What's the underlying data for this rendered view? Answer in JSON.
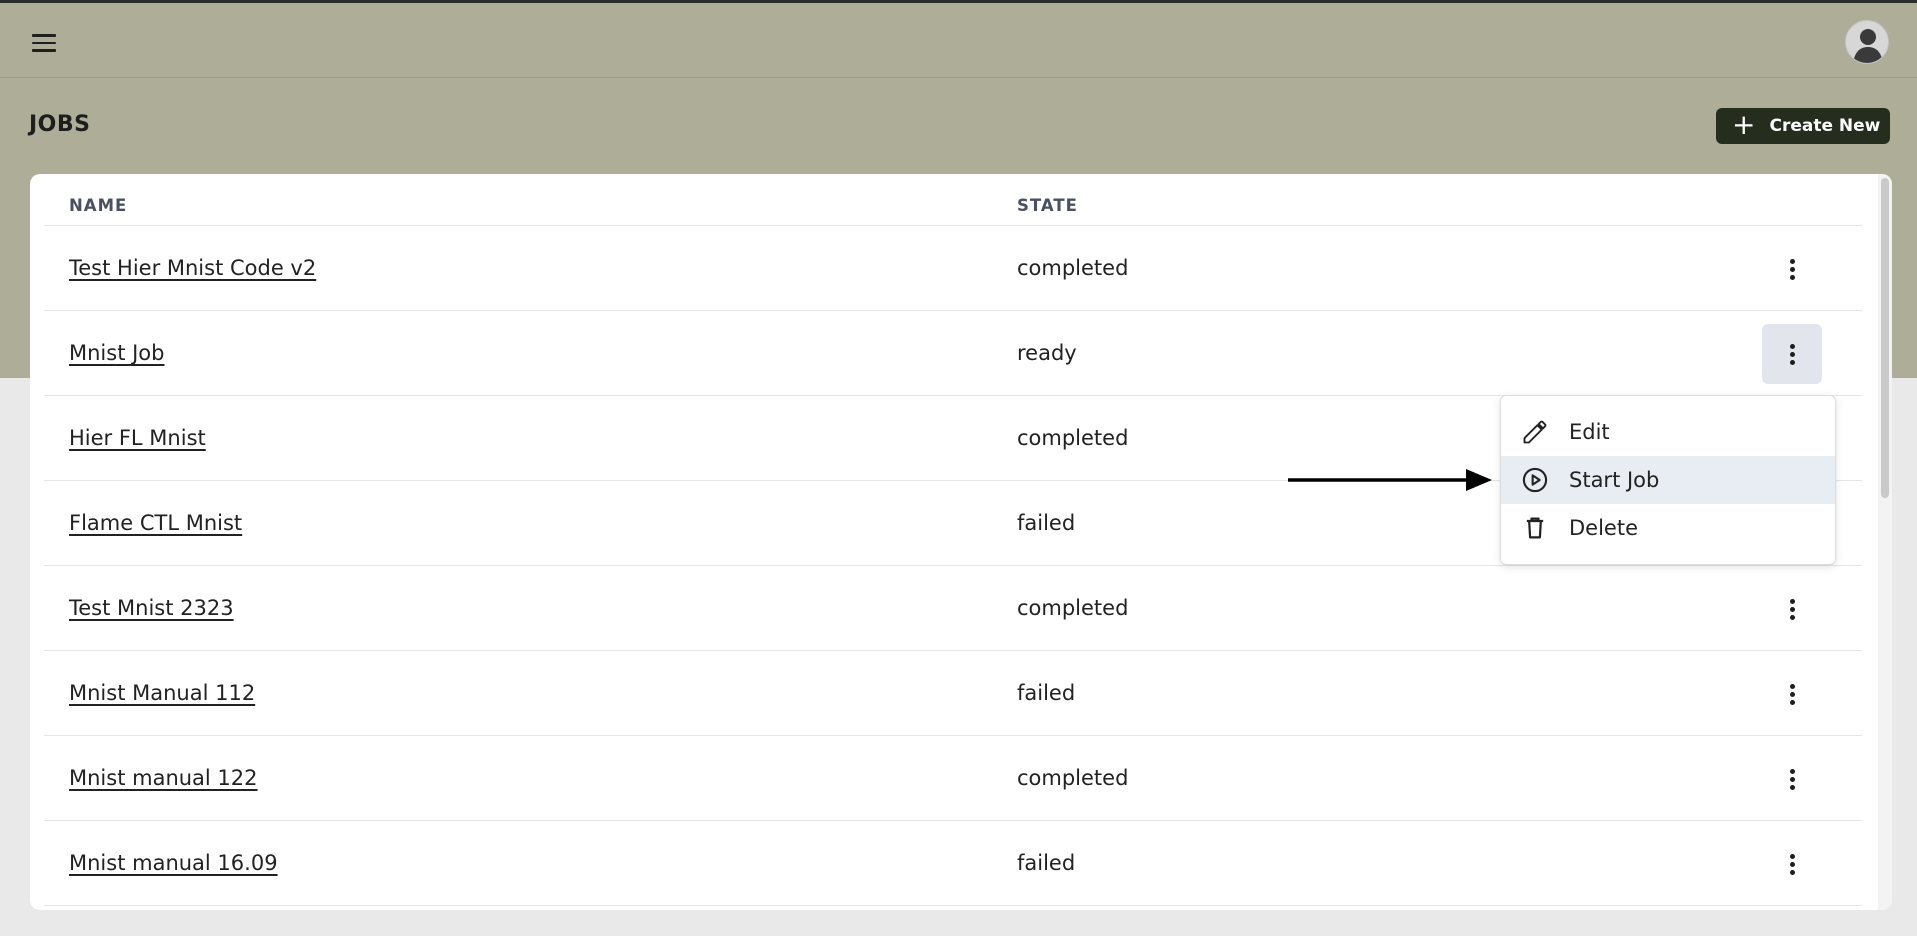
{
  "header": {
    "menu_icon": "hamburger-menu-icon",
    "avatar_icon": "user-avatar-icon"
  },
  "page": {
    "title": "JOBS",
    "create_label": "Create New",
    "create_icon": "plus-icon"
  },
  "table": {
    "columns": {
      "name": "NAME",
      "state": "STATE"
    },
    "rows": [
      {
        "name": "Test Hier Mnist Code v2",
        "state": "completed"
      },
      {
        "name": "Mnist Job",
        "state": "ready"
      },
      {
        "name": "Hier FL Mnist",
        "state": "completed"
      },
      {
        "name": "Flame CTL Mnist",
        "state": "failed"
      },
      {
        "name": "Test Mnist 2323",
        "state": "completed"
      },
      {
        "name": "Mnist Manual 112",
        "state": "failed"
      },
      {
        "name": "Mnist manual 122",
        "state": "completed"
      },
      {
        "name": "Mnist manual 16.09",
        "state": "failed"
      }
    ]
  },
  "context_menu": {
    "items": [
      {
        "label": "Edit",
        "icon": "pencil-icon"
      },
      {
        "label": "Start Job",
        "icon": "play-circle-icon"
      },
      {
        "label": "Delete",
        "icon": "trash-icon"
      }
    ]
  },
  "colors": {
    "header_bg": "#aeae98",
    "button_bg": "#242d1e",
    "highlight": "#e8edf3"
  }
}
